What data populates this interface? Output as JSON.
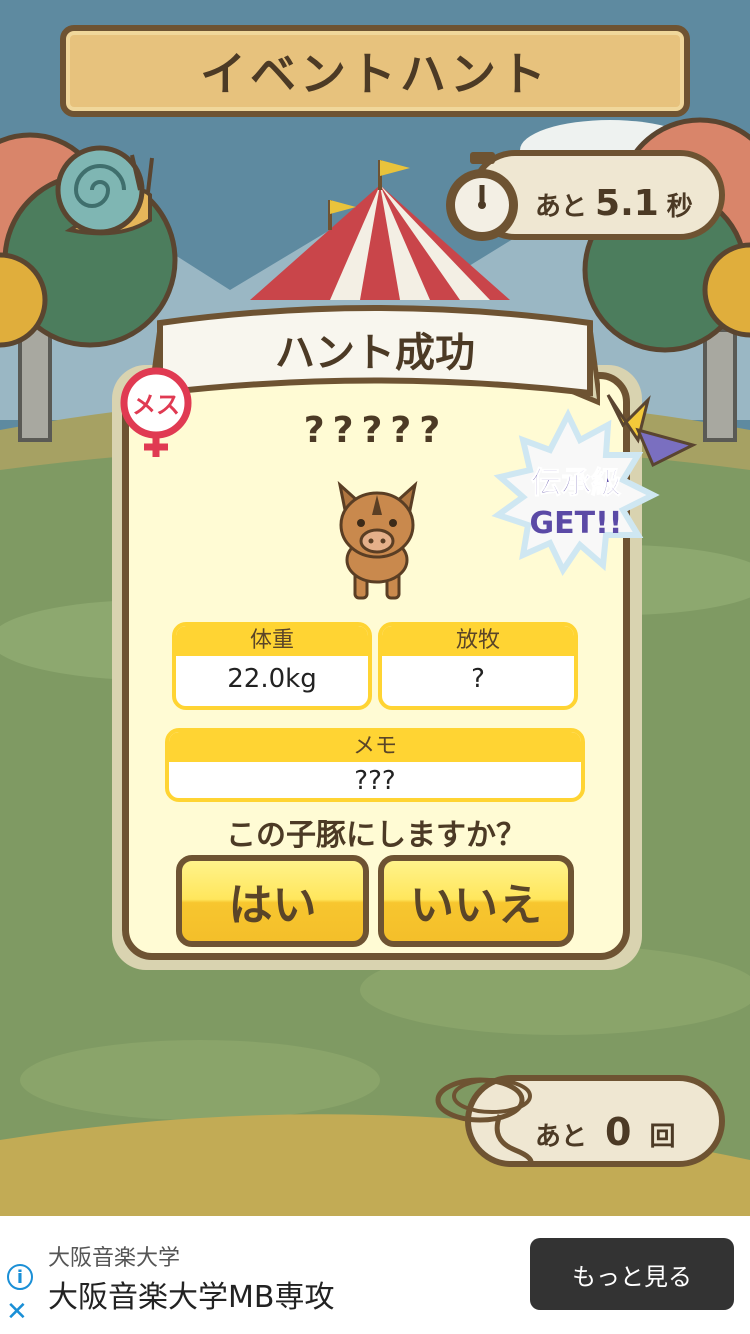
{
  "header": {
    "title": "イベントハント"
  },
  "timer": {
    "prefix": "あと",
    "value": "5.1",
    "unit": "秒"
  },
  "count": {
    "prefix": "あと",
    "value": "0",
    "unit": "回"
  },
  "dialog": {
    "title": "ハント成功",
    "gender_badge": "メス",
    "pig_name": "?????",
    "rank_badge": {
      "line1": "伝承級",
      "line2": "GET!!"
    },
    "weight": {
      "label": "体重",
      "value": "22.0kg"
    },
    "graze": {
      "label": "放牧",
      "value": "?"
    },
    "memo": {
      "label": "メモ",
      "value": "???"
    },
    "question": "この子豚にしますか？",
    "yes_label": "はい",
    "no_label": "いいえ"
  },
  "ad": {
    "small_text": "大阪音楽大学",
    "headline": "大阪音楽大学MB専攻",
    "cta_label": "もっと見る",
    "info_icon": "i"
  },
  "colors": {
    "accent_yellow": "#ffd433",
    "dialog_bg": "#fffbd4",
    "frame_brown": "#6e5332",
    "ad_info_blue": "#1a8fd6"
  },
  "icons": [
    "snail-icon",
    "stopwatch-icon",
    "lasso-icon",
    "female-icon",
    "boar-icon"
  ]
}
